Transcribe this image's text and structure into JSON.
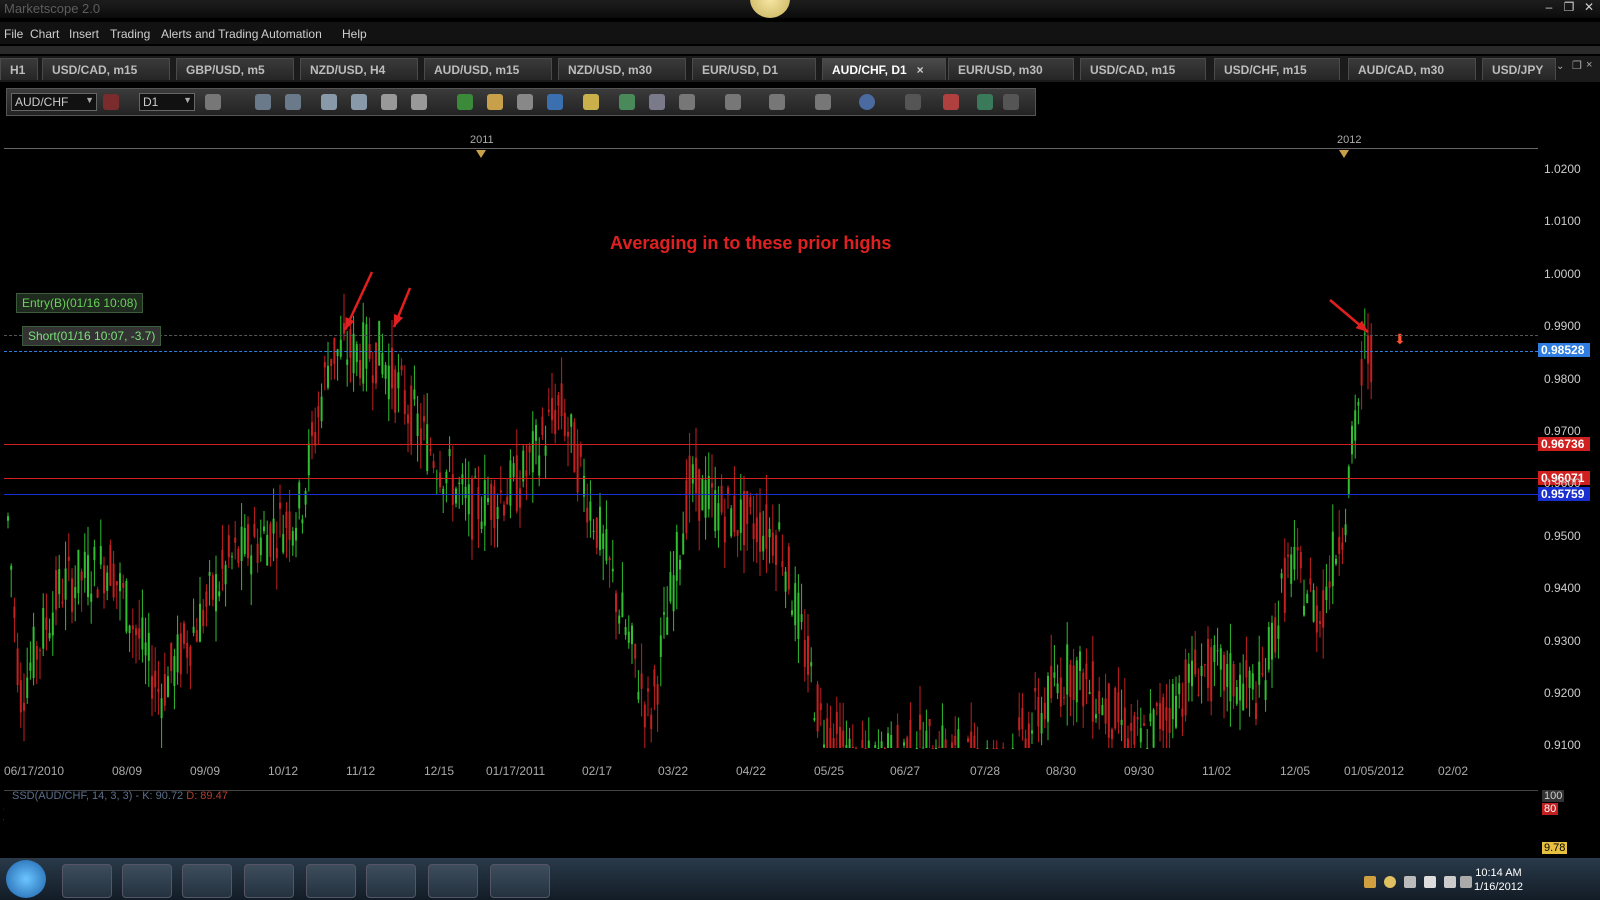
{
  "window": {
    "title": "Marketscope 2.0",
    "buttons": [
      "–",
      "❐",
      "✕"
    ]
  },
  "menu": [
    "File",
    "Chart",
    "Insert",
    "Trading",
    "Alerts and Trading Automation",
    "Help"
  ],
  "tabs": [
    {
      "label": "H1",
      "active": false
    },
    {
      "label": "USD/CAD, m15",
      "active": false
    },
    {
      "label": "GBP/USD, m5",
      "active": false
    },
    {
      "label": "NZD/USD, H4",
      "active": false
    },
    {
      "label": "AUD/USD, m15",
      "active": false
    },
    {
      "label": "NZD/USD, m30",
      "active": false
    },
    {
      "label": "EUR/USD, D1",
      "active": false
    },
    {
      "label": "AUD/CHF, D1",
      "active": true
    },
    {
      "label": "EUR/USD, m30",
      "active": false
    },
    {
      "label": "USD/CAD, m15",
      "active": false
    },
    {
      "label": "USD/CHF, m15",
      "active": false
    },
    {
      "label": "AUD/CAD, m30",
      "active": false
    },
    {
      "label": "USD/JPY",
      "active": false
    }
  ],
  "toolbar": {
    "symbol": "AUD/CHF",
    "timeframe": "D1"
  },
  "chart": {
    "years": [
      "2011",
      "2012"
    ],
    "annotation": "Averaging in to these prior highs",
    "entry_label": "Entry(B)(01/16 10:08)",
    "short_label": "Short(01/16 10:07, -3.7)",
    "y_ticks": [
      "1.0200",
      "1.0100",
      "1.0000",
      "0.9900",
      "0.9800",
      "0.9700",
      "0.9600",
      "0.9500",
      "0.9400",
      "0.9300",
      "0.9200",
      "0.9100"
    ],
    "x_ticks": [
      "06/17/2010",
      "08/09",
      "09/09",
      "10/12",
      "11/12",
      "12/15",
      "01/17/2011",
      "02/17",
      "03/22",
      "04/22",
      "05/25",
      "06/27",
      "07/28",
      "08/30",
      "09/30",
      "11/02",
      "12/05",
      "01/05/2012",
      "02/02"
    ],
    "levels": [
      {
        "value": "0.98528",
        "color": "#2f7de0"
      },
      {
        "value": "0.96736",
        "color": "#d02020"
      },
      {
        "value": "0.96071",
        "color": "#d02020"
      },
      {
        "value": "0.95759",
        "color": "#1a2fd0"
      }
    ]
  },
  "oscillator": {
    "title": "SSD(AUD/CHF, 14, 3, 3) -",
    "k_text": "K: 90.72",
    "d_text": "D: 89.47",
    "scale": [
      "100",
      "80",
      "9.78"
    ]
  },
  "clock": {
    "time": "10:14 AM",
    "date": "1/16/2012"
  },
  "colors": {
    "bull": "#2fbf2f",
    "bear": "#c42020",
    "osc_k": "#3fb0c0",
    "osc_d": "#d05030"
  }
}
